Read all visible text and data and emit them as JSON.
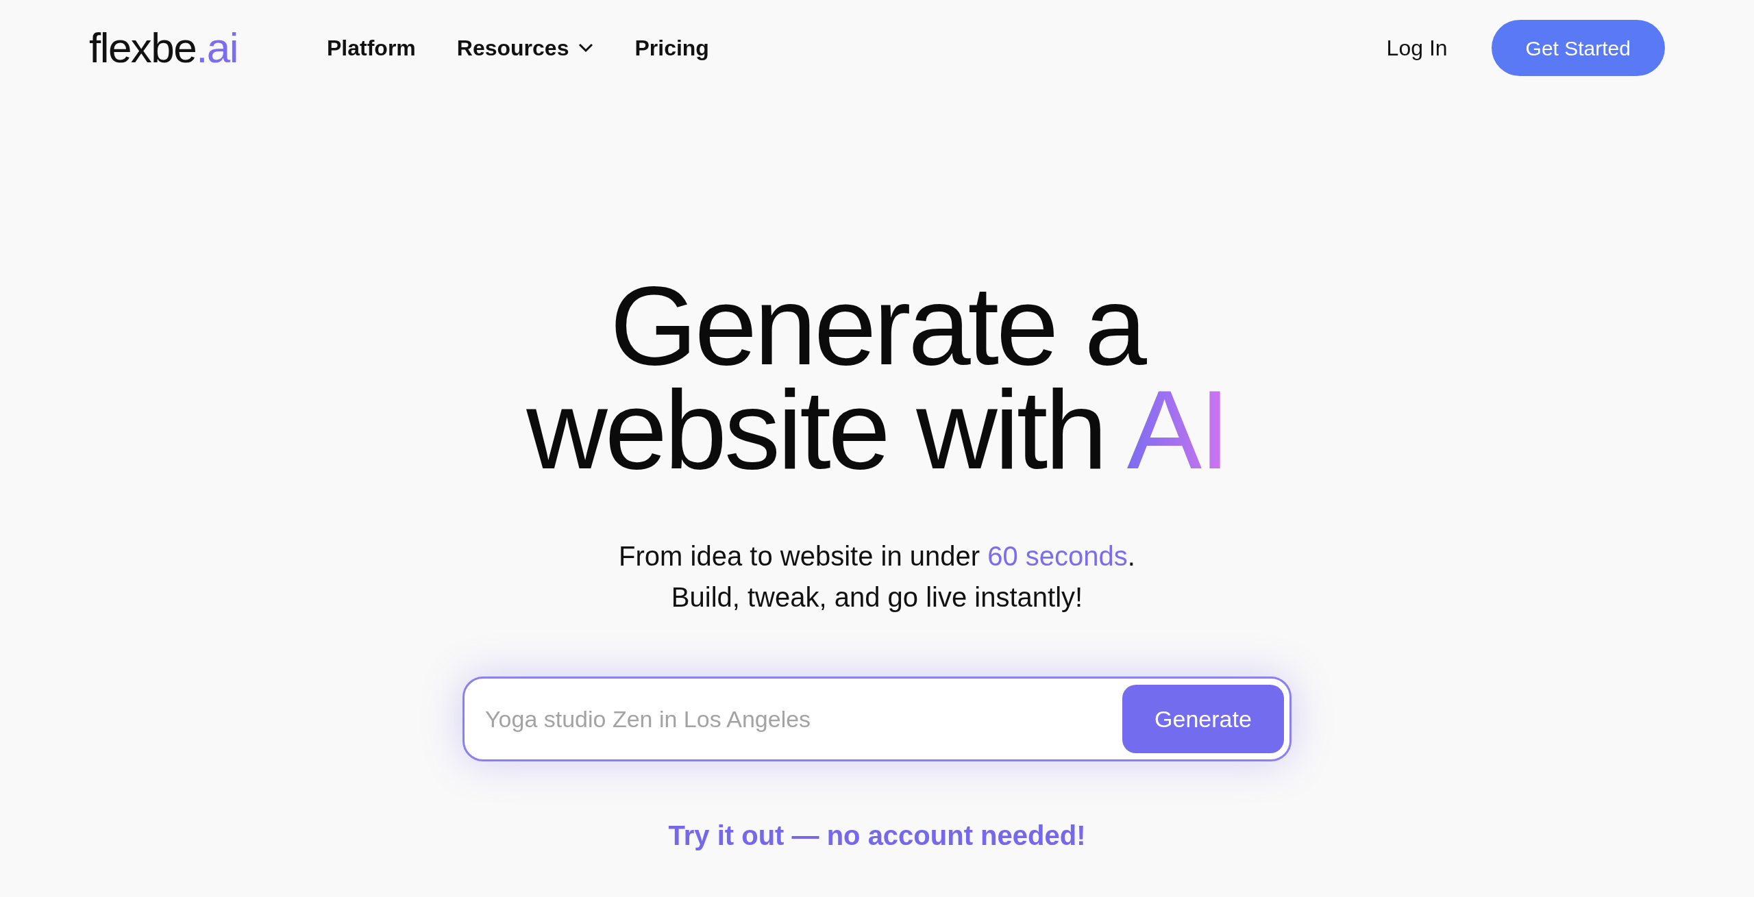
{
  "header": {
    "logo": {
      "name": "flexbe",
      "suffix": ".ai"
    },
    "nav": [
      {
        "label": "Platform",
        "has_menu": false
      },
      {
        "label": "Resources",
        "has_menu": true
      },
      {
        "label": "Pricing",
        "has_menu": false
      }
    ],
    "login": "Log In",
    "cta": "Get Started"
  },
  "hero": {
    "heading_lines": [
      "Generate a",
      "website with"
    ],
    "heading_highlight": "AI",
    "subtitle": {
      "before": "From idea to website in under ",
      "highlight": "60 seconds",
      "after": ".",
      "line2": "Build, tweak, and go live instantly!"
    },
    "prompt": {
      "placeholder": "Yoga studio Zen in Los Angeles",
      "button": "Generate"
    },
    "note": "Try it out — no account needed!"
  }
}
